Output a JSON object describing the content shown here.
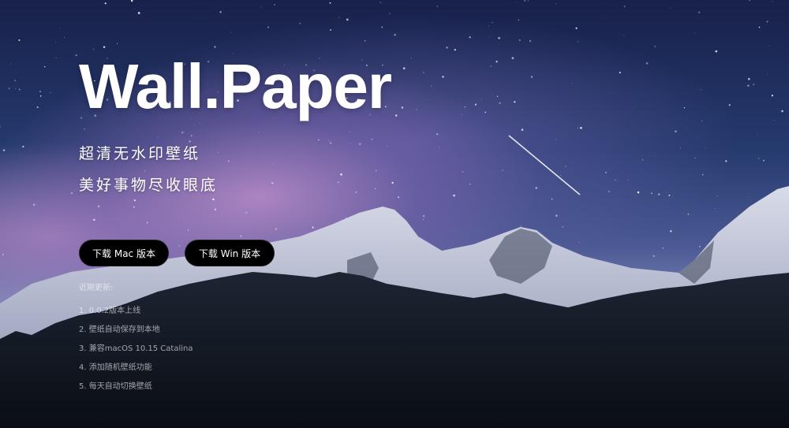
{
  "hero": {
    "title": "Wall.Paper",
    "taglines": [
      "超清无水印壁纸",
      "美好事物尽收眼底"
    ],
    "buttons": {
      "mac": "下载 Mac 版本",
      "win": "下载 Win 版本"
    }
  },
  "updates": {
    "title": "近期更新:",
    "items": [
      "1. 0.0.2版本上线",
      "2. 壁纸自动保存到本地",
      "3. 兼容macOS 10.15 Catalina",
      "4. 添加随机壁纸功能",
      "5. 每天自动切换壁纸"
    ]
  },
  "colors": {
    "button_bg": "#000000",
    "title_text": "#ffffff",
    "sky_top": "#18214a",
    "nebula_pink": "#ce96d2"
  }
}
